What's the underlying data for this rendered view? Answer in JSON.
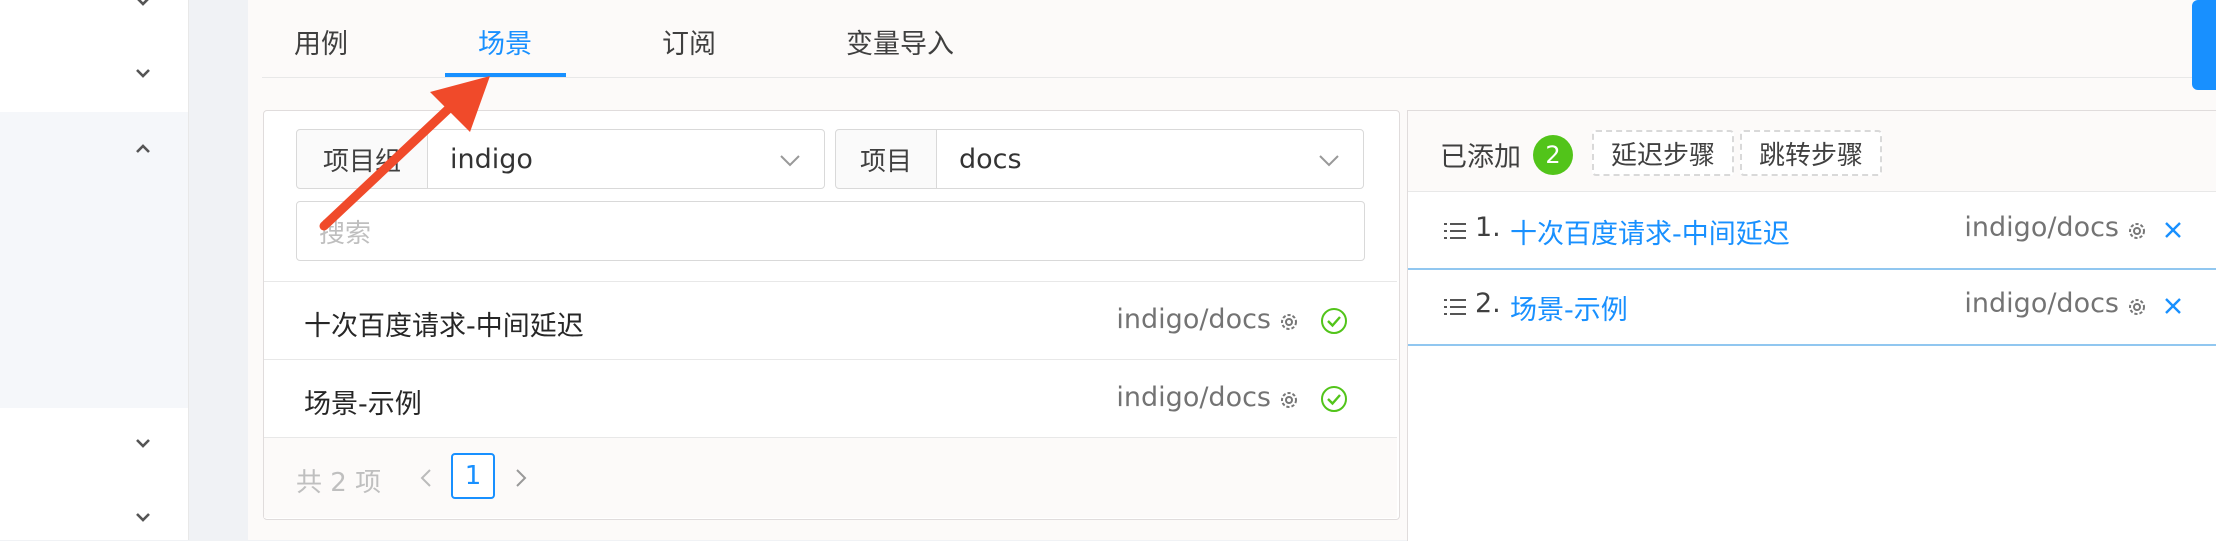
{
  "colors": {
    "primary": "#1890ff",
    "success": "#52c41a",
    "arrow": "#f04a2a"
  },
  "tabs": [
    {
      "label": "用例"
    },
    {
      "label": "场景"
    },
    {
      "label": "订阅"
    },
    {
      "label": "变量导入"
    }
  ],
  "active_tab": "场景",
  "filters": {
    "project_group_label": "项目组",
    "project_group_value": "indigo",
    "project_label": "项目",
    "project_value": "docs",
    "search_placeholder": "搜索"
  },
  "scene_list": [
    {
      "name": "十次百度请求-中间延迟",
      "project": "indigo/docs",
      "icons": [
        "gear-icon",
        "check-circle-icon"
      ]
    },
    {
      "name": "场景-示例",
      "project": "indigo/docs",
      "icons": [
        "gear-icon",
        "check-circle-icon"
      ]
    }
  ],
  "pagination": {
    "total_text": "共 2 项",
    "current_page": "1"
  },
  "added": {
    "label": "已添加",
    "count": "2",
    "delay_button": "延迟步骤",
    "jump_button": "跳转步骤",
    "steps": [
      {
        "index": "1.",
        "name": "十次百度请求-中间延迟",
        "project": "indigo/docs"
      },
      {
        "index": "2.",
        "name": "场景-示例",
        "project": "indigo/docs"
      }
    ]
  },
  "sidebar": {
    "chevrons": [
      "chevron-down-icon",
      "chevron-down-icon",
      "chevron-up-icon",
      "chevron-down-icon",
      "chevron-down-icon"
    ]
  }
}
